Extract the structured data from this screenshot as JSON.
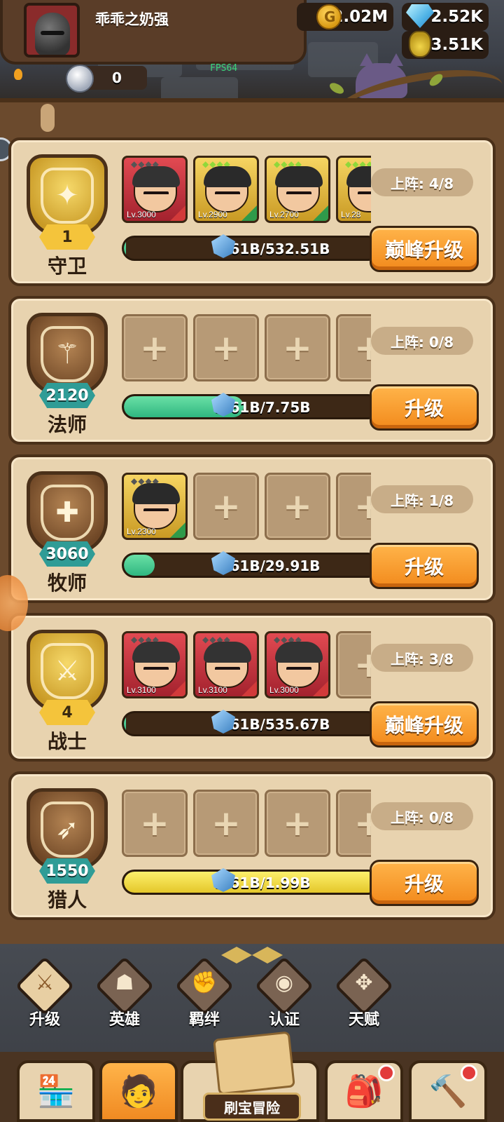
{
  "player": {
    "name": "乖乖之奶强",
    "gold": "2.02M",
    "gems": "2.52K",
    "potion": "3.51K",
    "tokens": "0",
    "fps": "FPS64"
  },
  "classes": [
    {
      "name": "守卫",
      "badge": "1",
      "badge_style": "gold",
      "team": "上阵: 4/8",
      "progress_text": "3.61B/532.51B",
      "progress_value": 0.007,
      "progress_color": "green",
      "button": "巅峰升级",
      "icon": "shield-icon",
      "heroes": [
        {
          "frame": "red",
          "level": "Lv.3000",
          "stars": "gray"
        },
        {
          "frame": "gold",
          "level": "Lv.2900",
          "stars": "green"
        },
        {
          "frame": "gold",
          "level": "Lv.2700",
          "stars": "green"
        },
        {
          "frame": "gold",
          "level": "Lv.28",
          "stars": "green"
        }
      ]
    },
    {
      "name": "法师",
      "badge": "2120",
      "badge_style": "teal",
      "team": "上阵: 0/8",
      "progress_text": "3.61B/7.75B",
      "progress_value": 0.47,
      "progress_color": "green",
      "button": "升级",
      "icon": "staff-icon",
      "heroes": []
    },
    {
      "name": "牧师",
      "badge": "3060",
      "badge_style": "teal",
      "team": "上阵: 1/8",
      "progress_text": "3.61B/29.91B",
      "progress_value": 0.12,
      "progress_color": "green",
      "button": "升级",
      "icon": "holy-cross-icon",
      "heroes": [
        {
          "frame": "gold",
          "level": "Lv.2300",
          "stars": "gray"
        }
      ]
    },
    {
      "name": "战士",
      "badge": "4",
      "badge_style": "gold",
      "team": "上阵: 3/8",
      "progress_text": "3.61B/535.67B",
      "progress_value": 0.007,
      "progress_color": "green",
      "button": "巅峰升级",
      "icon": "sword-icon",
      "heroes": [
        {
          "frame": "red",
          "level": "Lv.3100",
          "stars": "gray"
        },
        {
          "frame": "red",
          "level": "Lv.3100",
          "stars": "gray"
        },
        {
          "frame": "red",
          "level": "Lv.3000",
          "stars": "gray"
        }
      ]
    },
    {
      "name": "猎人",
      "badge": "1550",
      "badge_style": "teal",
      "team": "上阵: 0/8",
      "progress_text": "3.61B/1.99B",
      "progress_value": 1.0,
      "progress_color": "yellow",
      "button": "升级",
      "icon": "bow-icon",
      "heroes": []
    }
  ],
  "tabs": [
    {
      "label": "升级",
      "icon": "sword-upgrade-icon",
      "active": true
    },
    {
      "label": "英雄",
      "icon": "hero-icon",
      "active": false
    },
    {
      "label": "羁绊",
      "icon": "fist-icon",
      "active": false
    },
    {
      "label": "认证",
      "icon": "eye-icon",
      "active": false
    },
    {
      "label": "天赋",
      "icon": "talent-icon",
      "active": false
    }
  ],
  "bottom_nav": {
    "adventure_label": "刷宝冒险"
  },
  "colors": {
    "accent_orange": "#f28a1c",
    "card_bg": "#e8d3af",
    "frame_brown": "#4a3019",
    "badge_teal": "#2f9c96",
    "badge_gold": "#f4c43b"
  }
}
